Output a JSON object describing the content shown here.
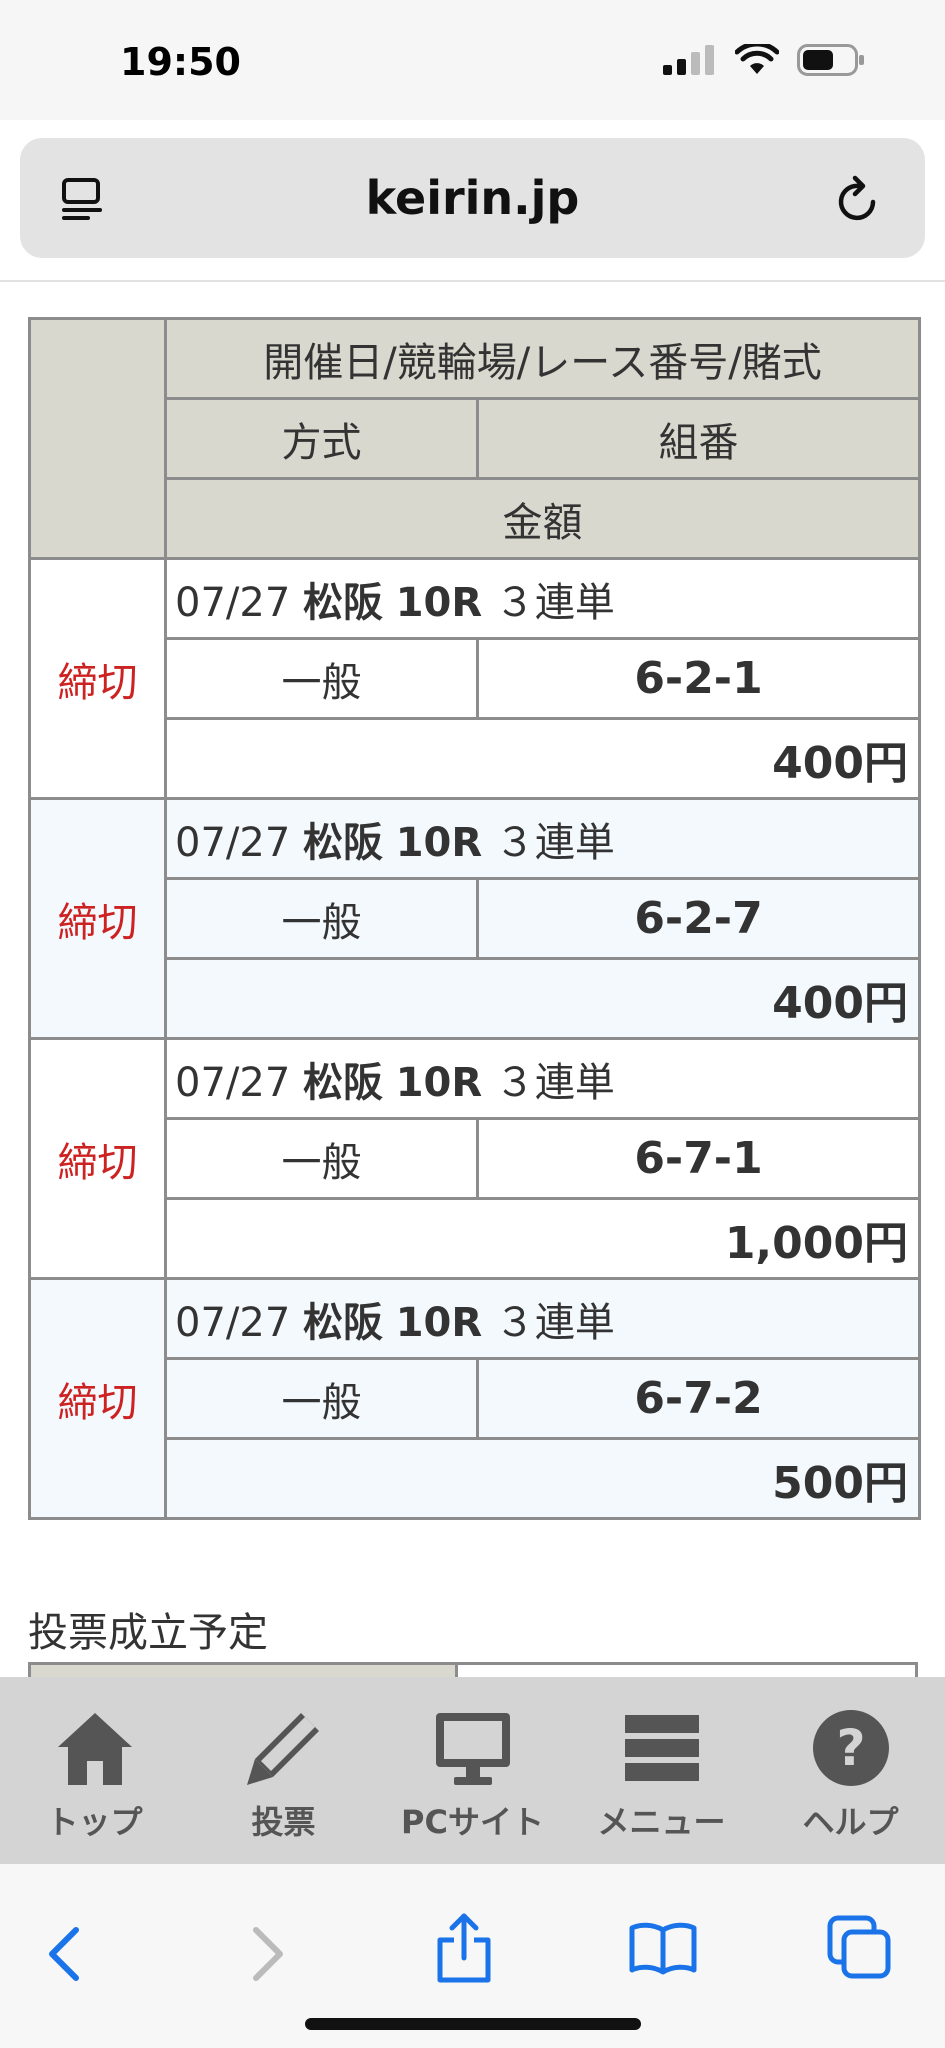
{
  "status_bar": {
    "time": "19:50"
  },
  "browser": {
    "url": "keirin.jp"
  },
  "table": {
    "header": {
      "row1": "開催日/競輪場/レース番号/賭式",
      "method": "方式",
      "combo": "組番",
      "amount": "金額"
    },
    "rows": [
      {
        "status": "締切",
        "date": "07/27",
        "venue": "松阪",
        "race": "10R",
        "bet_type": "３連単",
        "method": "一般",
        "combo": "6-2-1",
        "amount": "400円"
      },
      {
        "status": "締切",
        "date": "07/27",
        "venue": "松阪",
        "race": "10R",
        "bet_type": "３連単",
        "method": "一般",
        "combo": "6-2-7",
        "amount": "400円"
      },
      {
        "status": "締切",
        "date": "07/27",
        "venue": "松阪",
        "race": "10R",
        "bet_type": "３連単",
        "method": "一般",
        "combo": "6-7-1",
        "amount": "1,000円"
      },
      {
        "status": "締切",
        "date": "07/27",
        "venue": "松阪",
        "race": "10R",
        "bet_type": "３連単",
        "method": "一般",
        "combo": "6-7-2",
        "amount": "500円"
      }
    ]
  },
  "section": {
    "title": "投票成立予定"
  },
  "tab_bar": {
    "items": [
      {
        "label": "トップ",
        "icon": "home-icon"
      },
      {
        "label": "投票",
        "icon": "pencil-icon"
      },
      {
        "label": "PCサイト",
        "icon": "monitor-icon"
      },
      {
        "label": "メニュー",
        "icon": "menu-icon"
      },
      {
        "label": "ヘルプ",
        "icon": "help-icon"
      }
    ]
  },
  "colors": {
    "accent": "#1a73e8",
    "status_red": "#cc2222",
    "header_bg": "#d8d8cf",
    "alt_row_bg": "#f4f9fd"
  }
}
